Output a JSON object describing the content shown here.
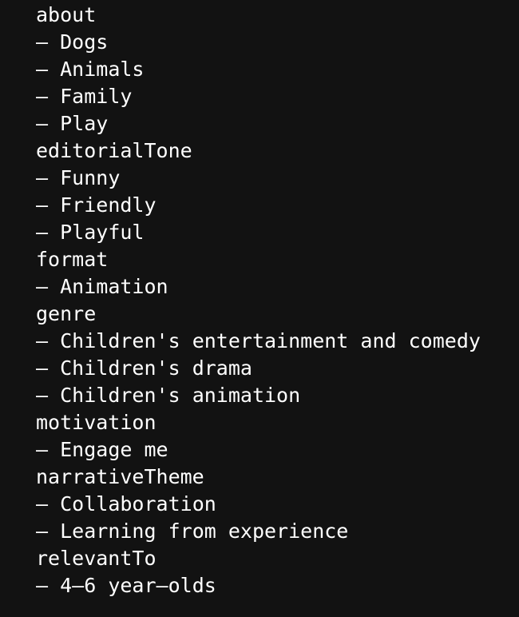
{
  "sections": [
    {
      "key": "about",
      "items": [
        "Dogs",
        "Animals",
        "Family",
        "Play"
      ]
    },
    {
      "key": "editorialTone",
      "items": [
        "Funny",
        "Friendly",
        "Playful"
      ]
    },
    {
      "key": "format",
      "items": [
        "Animation"
      ]
    },
    {
      "key": "genre",
      "items": [
        "Children's entertainment and comedy",
        "Children's drama",
        "Children's animation"
      ]
    },
    {
      "key": "motivation",
      "items": [
        "Engage me"
      ]
    },
    {
      "key": "narrativeTheme",
      "items": [
        "Collaboration",
        "Learning from experience"
      ]
    },
    {
      "key": "relevantTo",
      "items": [
        "4–6 year–olds"
      ]
    }
  ],
  "bullet": "–",
  "colors": {
    "background": "#121212",
    "text": "#ffffff"
  }
}
